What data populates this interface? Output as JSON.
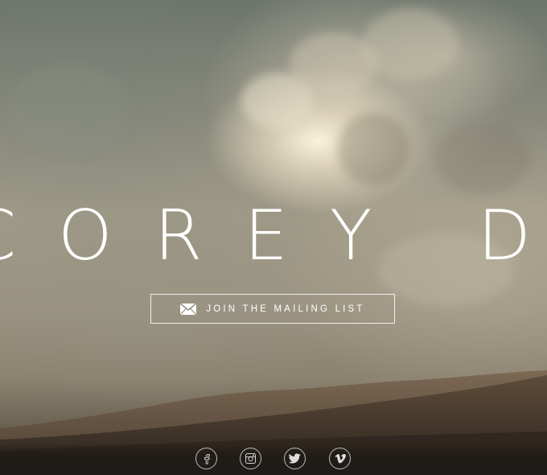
{
  "hero": {
    "title": "COREY DANKS",
    "background": "desert-dunes-under-cloudy-sky"
  },
  "mailing_button": {
    "label": "JOIN THE MAILING LIST",
    "icon": "envelope-icon"
  },
  "socials": [
    {
      "name": "facebook",
      "icon": "facebook-icon"
    },
    {
      "name": "instagram",
      "icon": "instagram-icon"
    },
    {
      "name": "twitter",
      "icon": "twitter-icon"
    },
    {
      "name": "vimeo",
      "icon": "vimeo-icon"
    }
  ],
  "colors": {
    "text": "#ffffff",
    "button_border": "#ffffff",
    "sky_top": "#6d756d",
    "sky_glow": "#fff6de",
    "dune": "#5e4c3a",
    "ground": "#1f1b18"
  }
}
